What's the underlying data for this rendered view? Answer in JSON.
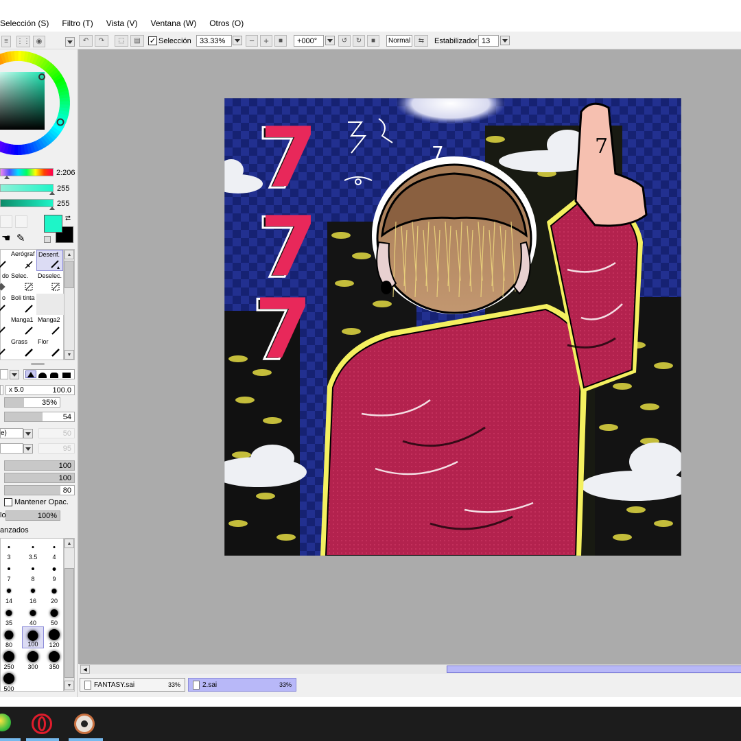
{
  "menu": [
    "Selección (S)",
    "Filtro (T)",
    "Vista (V)",
    "Ventana (W)",
    "Otros (O)"
  ],
  "toolbar": {
    "selection_label": "Selección",
    "selection_checked": true,
    "zoom": "33.33%",
    "rotation": "+000°",
    "blend_mode": "Normal",
    "stabilizer_label": "Estabilizador",
    "stabilizer_value": "13"
  },
  "color_panel": {
    "hue_value": "2:206",
    "sat_value": "255",
    "val_value": "255",
    "foreground_color": "#1ef5c8",
    "background_color": "#000000",
    "square_color": "#19a47a"
  },
  "tools": {
    "items": [
      "Aerógraf",
      "Desenf.",
      "dor",
      "Selec.",
      "Deselec.",
      "o",
      "Boli tinta",
      "Manga1",
      "Manga2",
      "Grass",
      "Flor"
    ],
    "selected": "Desenf."
  },
  "brush_settings": {
    "size_multiplier": "x 5.0",
    "size": "100.0",
    "min_size": "35%",
    "density": "54",
    "texture_hint": "50",
    "blend_hint": "95",
    "param1": "100",
    "param2": "100",
    "param3": "80",
    "keep_opacity_label": "Mantener Opac.",
    "opacity_label_tail": "lo",
    "opacity": "100%",
    "advanced_label": "anzados"
  },
  "brush_sizes": [
    "3",
    "3.5",
    "4",
    "7",
    "8",
    "9",
    "14",
    "16",
    "20",
    "35",
    "40",
    "50",
    "80",
    "100",
    "120",
    "250",
    "300",
    "350",
    "500"
  ],
  "selected_brush_size": "100",
  "files": [
    {
      "name": "FANTASY.sai",
      "zoom": "33%"
    },
    {
      "name": "2.sai",
      "zoom": "33%"
    }
  ],
  "artwork": {
    "title_numbers": [
      "7",
      "7",
      "7"
    ],
    "finger_mark": "7",
    "head_mark": "7"
  }
}
